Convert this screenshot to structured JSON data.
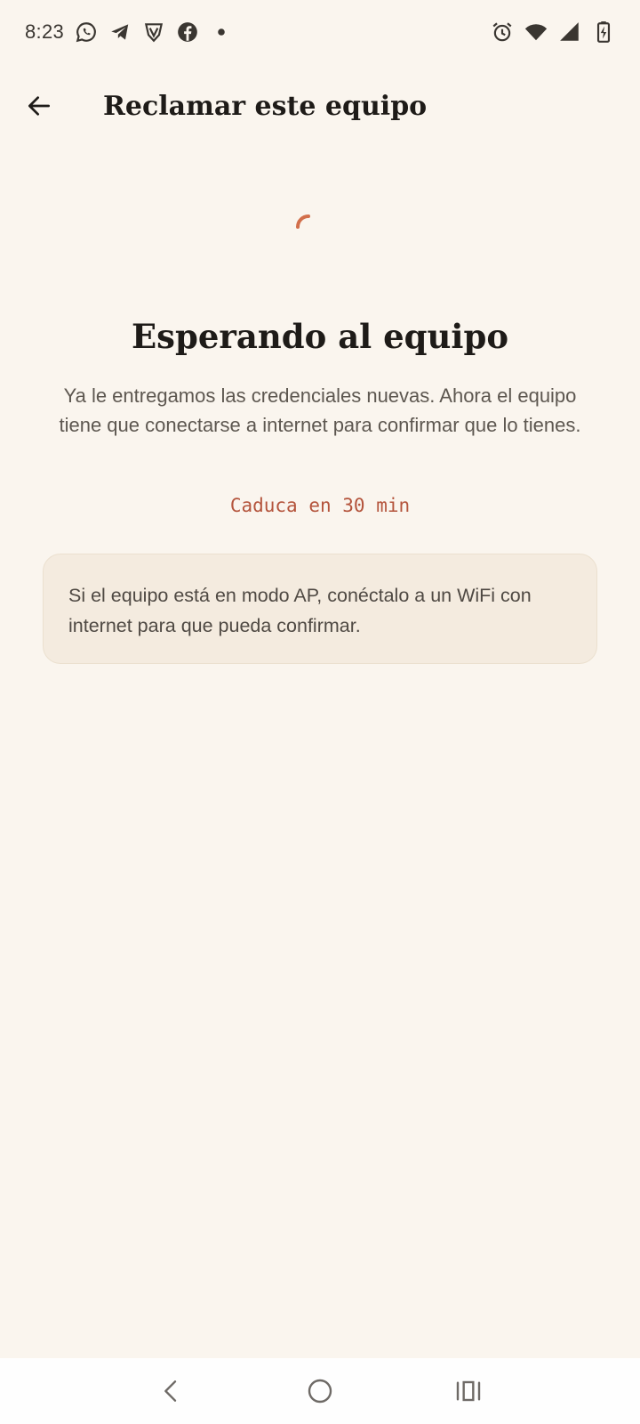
{
  "status_bar": {
    "time": "8:23",
    "left_icons": [
      "whatsapp-icon",
      "telegram-icon",
      "vpn-shield-icon",
      "facebook-icon",
      "dot-icon"
    ],
    "right_icons": [
      "alarm-icon",
      "wifi-icon",
      "cell-signal-icon",
      "battery-charging-icon"
    ]
  },
  "app_bar": {
    "title": "Reclamar este equipo",
    "back_icon": "arrow-left-icon"
  },
  "main": {
    "spinner_color": "#d26f4b",
    "heading": "Esperando al equipo",
    "description": "Ya le entregamos las credenciales nuevas. Ahora el equipo tiene que conectarse a internet para confirmar que lo tienes.",
    "expiry": "Caduca en 30 min",
    "info": "Si el equipo está en modo AP, conéctalo a un WiFi con internet para que pueda confirmar."
  },
  "colors": {
    "background": "#faf5ee",
    "accent": "#b4543c",
    "info_box": "#f4ebdf"
  },
  "nav_bar": {
    "icons": [
      "nav-back-icon",
      "nav-home-icon",
      "nav-recents-icon"
    ]
  }
}
